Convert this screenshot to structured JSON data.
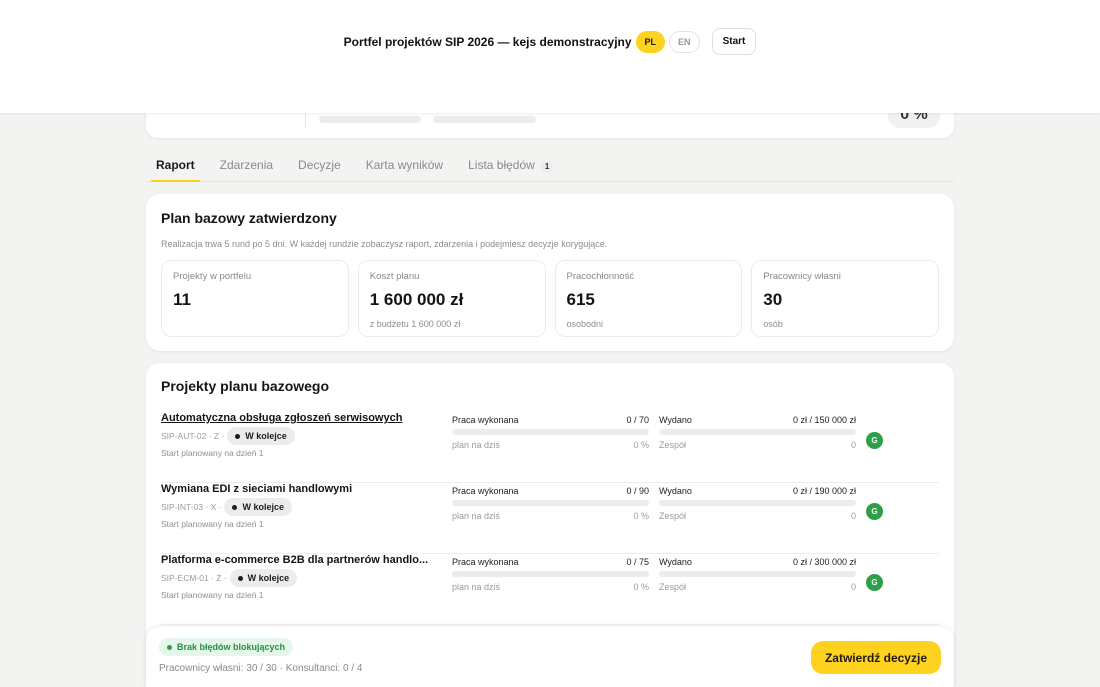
{
  "header": {
    "title": "Portfel projektów SIP 2026 — kejs demonstracyjny",
    "languages": [
      {
        "code": "PL",
        "active": true
      },
      {
        "code": "EN",
        "active": false
      }
    ],
    "start_label": "Start",
    "accent_color": "#ffd21f"
  },
  "summary": {
    "percent_label": "0 %"
  },
  "tabs": [
    {
      "label": "Raport",
      "active": true
    },
    {
      "label": "Zdarzenia",
      "active": false
    },
    {
      "label": "Decyzje",
      "active": false
    },
    {
      "label": "Karta wyników",
      "active": false
    },
    {
      "label": "Lista błędów",
      "active": false,
      "count": "1"
    }
  ],
  "baseline": {
    "title": "Plan bazowy zatwierdzony",
    "description": "Realizacja trwa 5 rund po 5 dni. W każdej rundzie zobaczysz raport, zdarzenia i podejmiesz decyzje korygujące.",
    "stats": [
      {
        "label": "Projekty w portfelu",
        "value": "11",
        "sub": ""
      },
      {
        "label": "Koszt planu",
        "value": "1 600 000 zł",
        "sub": "z budżetu 1 600 000 zł"
      },
      {
        "label": "Pracochłonność",
        "value": "615",
        "sub": "osobodni"
      },
      {
        "label": "Pracownicy własni",
        "value": "30",
        "sub": "osób"
      }
    ]
  },
  "projects": {
    "title": "Projekty planu bazowego",
    "work_label": "Praca wykonana",
    "plan_label": "plan na dziś",
    "spent_label": "Wydano",
    "team_label": "Zespół",
    "items": [
      {
        "name": "Automatyczna obsługa zgłoszeń serwisowych",
        "code_meta": "SIP-AUT-02 · Z ·",
        "status": "W kolejce",
        "start": "Start planowany na dzień 1",
        "work": "0 / 70",
        "work_fraction": 0,
        "plan_pct": "0 %",
        "spent": "0 zł / 150 000 zł",
        "spent_fraction": 0,
        "team": "0",
        "badge": "G",
        "underlined": true
      },
      {
        "name": "Wymiana EDI z sieciami handlowymi",
        "code_meta": "SIP-INT-03 · X ·",
        "status": "W kolejce",
        "start": "Start planowany na dzień 1",
        "work": "0 / 90",
        "work_fraction": 0,
        "plan_pct": "0 %",
        "spent": "0 zł / 190 000 zł",
        "spent_fraction": 0,
        "team": "0",
        "badge": "G",
        "underlined": false
      },
      {
        "name": "Platforma e-commerce B2B dla partnerów handlo...",
        "code_meta": "SIP-ECM-01 · Z ·",
        "status": "W kolejce",
        "start": "Start planowany na dzień 1",
        "work": "0 / 75",
        "work_fraction": 0,
        "plan_pct": "0 %",
        "spent": "0 zł / 300 000 zł",
        "spent_fraction": 0,
        "team": "0",
        "badge": "G",
        "underlined": false
      }
    ]
  },
  "footer": {
    "status_badge": "Brak błędów blokujących",
    "staff_line": "Pracownicy własni: 30 / 30 · Konsultanci: 0 / 4",
    "confirm_label": "Zatwierdź decyzje",
    "ok_color": "#2e9e49"
  }
}
